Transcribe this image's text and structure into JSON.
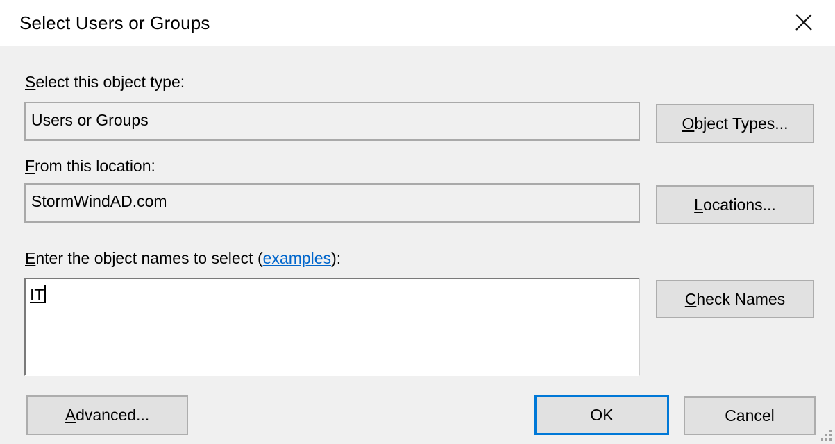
{
  "window": {
    "title": "Select Users or Groups",
    "close_icon": "close-icon"
  },
  "object_type": {
    "label_accesskey": "S",
    "label_rest": "elect this object type:",
    "value": "Users or Groups",
    "button_accesskey": "O",
    "button_rest": "bject Types..."
  },
  "location": {
    "label_accesskey": "F",
    "label_rest": "rom this location:",
    "value": "StormWindAD.com",
    "button_accesskey": "L",
    "button_rest": "ocations..."
  },
  "object_names": {
    "label_accesskey": "E",
    "label_rest": "nter the object names to select (",
    "link_text": "examples",
    "label_end": "):",
    "value": "IT",
    "button_accesskey": "C",
    "button_rest": "heck Names"
  },
  "footer": {
    "advanced_accesskey": "A",
    "advanced_rest": "dvanced...",
    "ok_label": "OK",
    "cancel_label": "Cancel"
  },
  "colors": {
    "dialog_background": "#f0f0f0",
    "default_button_border": "#0078d7",
    "link": "#0066cc"
  }
}
